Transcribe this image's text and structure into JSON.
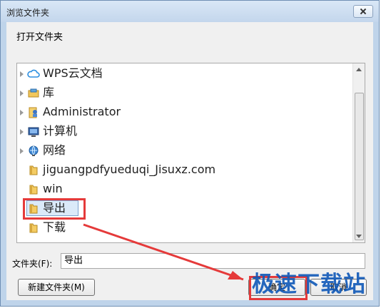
{
  "window": {
    "title": "浏览文件夹",
    "instruction": "打开文件夹"
  },
  "tree": {
    "items": [
      {
        "label": "WPS云文档",
        "icon": "cloud-icon"
      },
      {
        "label": "库",
        "icon": "library-icon"
      },
      {
        "label": "Administrator",
        "icon": "user-folder-icon"
      },
      {
        "label": "计算机",
        "icon": "computer-icon"
      },
      {
        "label": "网络",
        "icon": "network-icon"
      },
      {
        "label": "jiguangpdfyueduqi_Jisuxz.com",
        "icon": "folder-icon"
      },
      {
        "label": "win",
        "icon": "folder-icon"
      },
      {
        "label": "导出",
        "icon": "folder-icon",
        "selected": true
      },
      {
        "label": "下载",
        "icon": "folder-icon"
      }
    ]
  },
  "folder": {
    "label": "文件夹(F):",
    "value": "导出"
  },
  "buttons": {
    "new_folder": "新建文件夹(M)",
    "ok": "确定",
    "cancel": "取消"
  },
  "watermark": {
    "text": "极速下载站"
  },
  "colors": {
    "annotation_red": "#e53a3a",
    "selection_blue": "#dbeaf9",
    "title_bar": "#d9e7f6",
    "watermark_blue": "#0f58b8"
  }
}
